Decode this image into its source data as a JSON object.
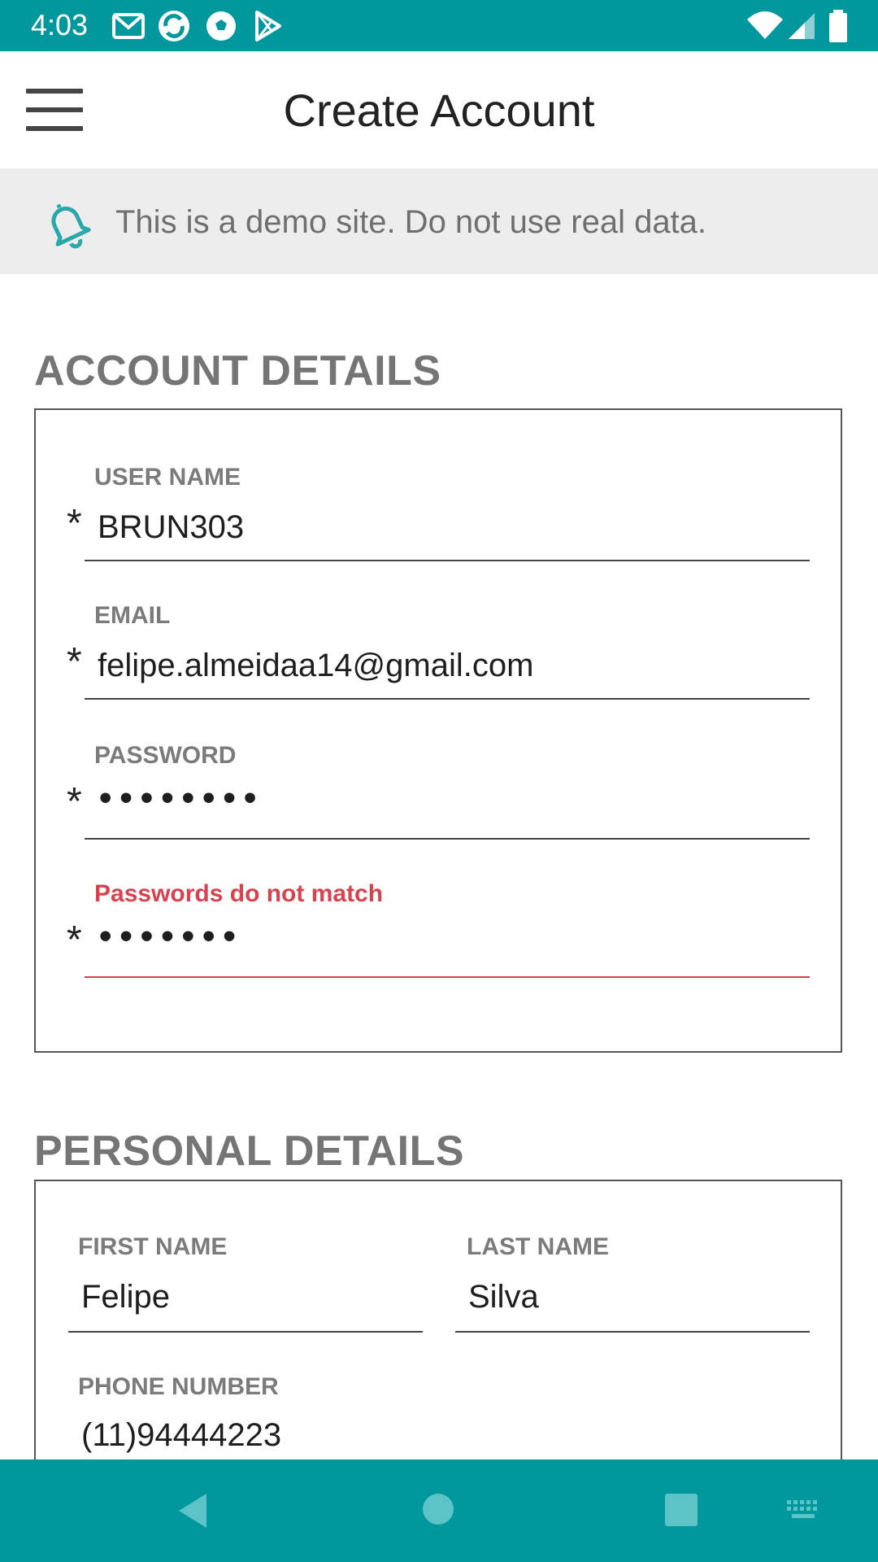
{
  "status": {
    "time": "4:03"
  },
  "app_bar": {
    "title": "Create Account"
  },
  "banner": {
    "text": "This is a demo site. Do not use real data."
  },
  "account_details": {
    "title": "ACCOUNT DETAILS",
    "fields": {
      "username": {
        "label": "USER NAME",
        "value": "BRUN303",
        "required": "*"
      },
      "email": {
        "label": "EMAIL",
        "value": "felipe.almeidaa14@gmail.com",
        "required": "*"
      },
      "password": {
        "label": "PASSWORD",
        "value": "••••••••",
        "required": "*"
      },
      "confirm_password": {
        "label": "Passwords do not match",
        "value": "•••••••",
        "required": "*"
      }
    }
  },
  "personal_details": {
    "title": "PERSONAL DETAILS",
    "fields": {
      "first_name": {
        "label": "FIRST NAME",
        "value": "Felipe"
      },
      "last_name": {
        "label": "LAST NAME",
        "value": "Silva"
      },
      "phone": {
        "label": "PHONE NUMBER",
        "value": "(11)94444223"
      }
    }
  },
  "colors": {
    "accent": "#00979d",
    "error": "#d6434f",
    "banner_bg": "#ededed"
  },
  "icons": [
    "gmail-icon",
    "sync-icon",
    "soccer-icon",
    "play-store-icon",
    "wifi-icon",
    "signal-icon",
    "battery-icon",
    "menu-icon",
    "bell-icon",
    "back-icon",
    "home-icon",
    "recents-icon",
    "keyboard-icon"
  ]
}
